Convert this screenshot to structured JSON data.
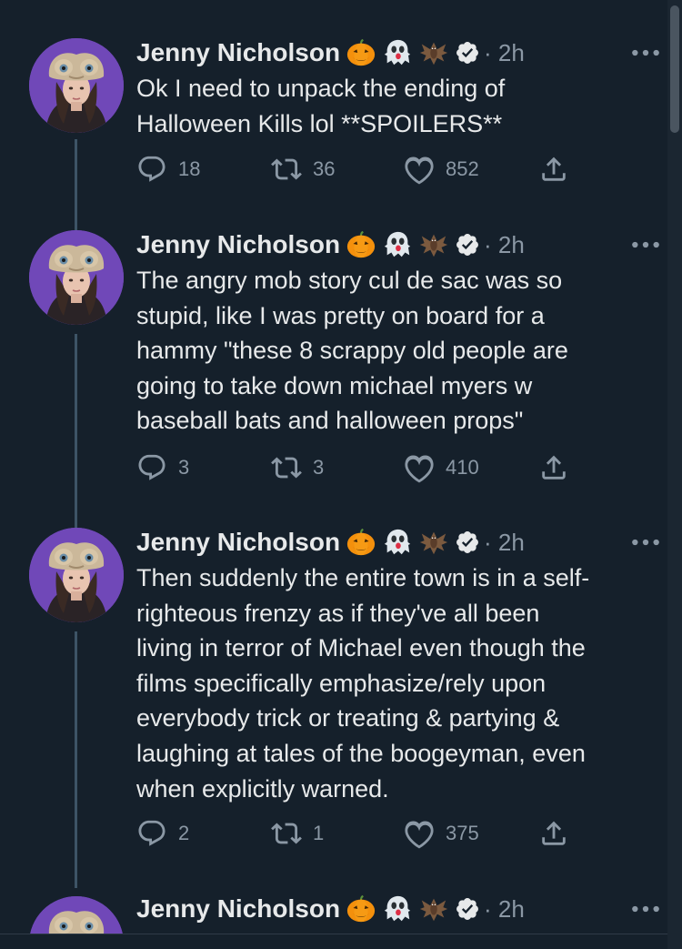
{
  "author": {
    "name": "Jenny Nicholson",
    "emojis": [
      "pumpkin-emoji",
      "ghost-emoji",
      "bat-emoji"
    ],
    "verified": true
  },
  "colors": {
    "background": "#15202b",
    "text": "#e7e9ea",
    "muted": "#8b98a5",
    "avatar_bg": "#7048b8",
    "thread_line": "#3d5466"
  },
  "tweets": [
    {
      "time": "· 2h",
      "text": "Ok I need to unpack the ending of\nHalloween Kills lol **SPOILERS**",
      "replies": "18",
      "retweets": "36",
      "likes": "852"
    },
    {
      "time": "· 2h",
      "text": "The angry mob story cul de sac was so\nstupid, like I was pretty on board for a\nhammy \"these 8 scrappy old people are\ngoing to take down michael myers w\nbaseball bats and halloween props\"",
      "replies": "3",
      "retweets": "3",
      "likes": "410"
    },
    {
      "time": "· 2h",
      "text": "Then suddenly the entire town is in a self-\nrighteous frenzy as if they've all been\nliving in terror of Michael even though the\nfilms specifically emphasize/rely upon\neverybody trick or treating & partying &\nlaughing at tales of the boogeyman, even\nwhen explicitly warned.",
      "replies": "2",
      "retweets": "1",
      "likes": "375"
    },
    {
      "time": "· 2h"
    }
  ]
}
